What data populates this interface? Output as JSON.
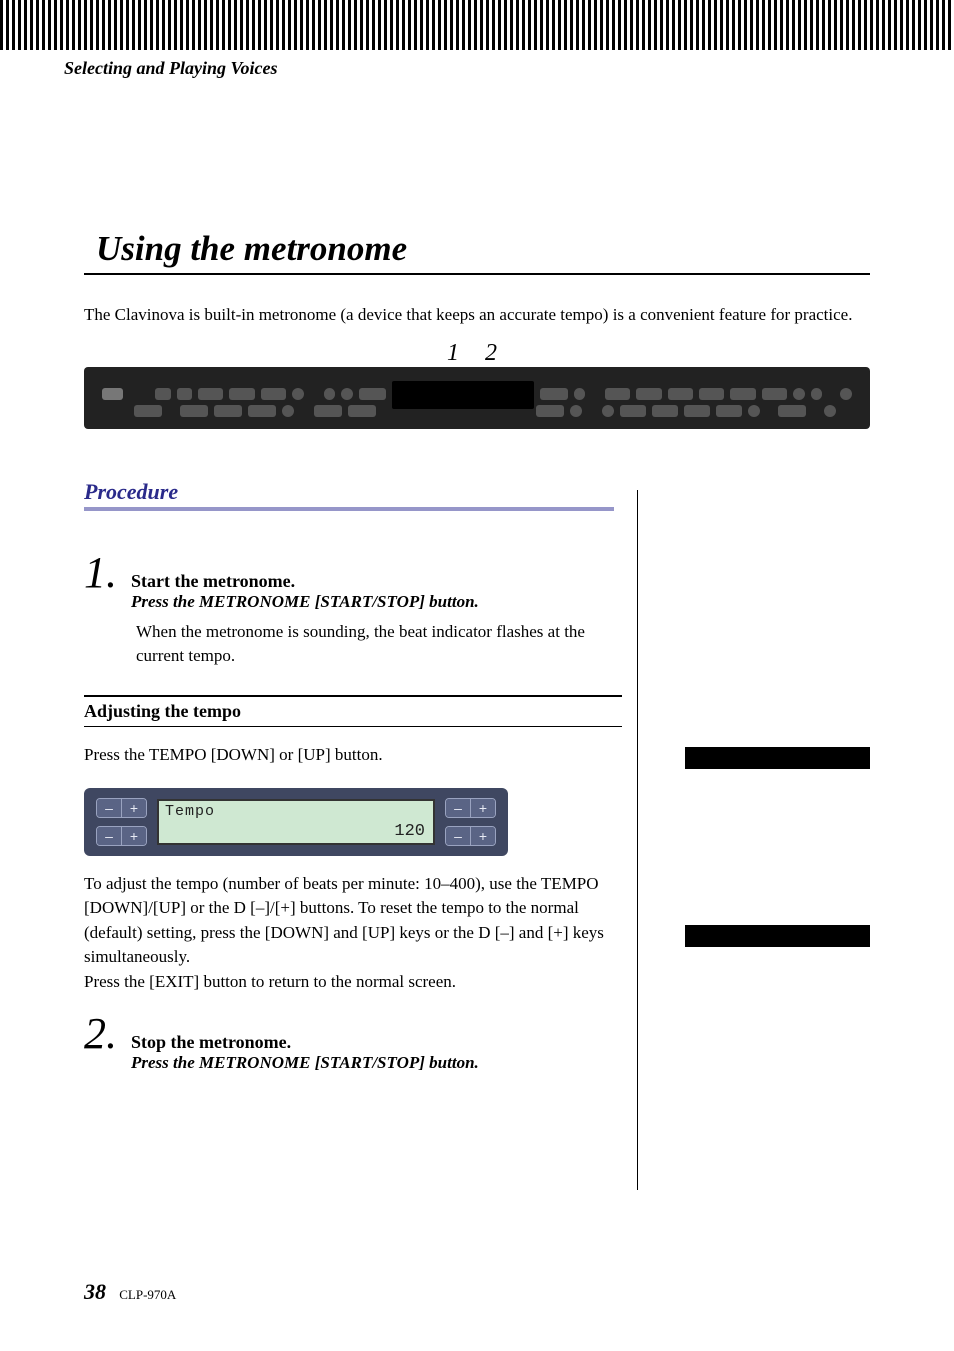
{
  "running_head": "Selecting and Playing Voices",
  "section_title": "Using the metronome",
  "intro": "The Clavinova is built-in metronome (a device that keeps an accurate tempo) is a convenient feature for practice.",
  "panel_markers": "1 2",
  "procedure_label": "Procedure",
  "steps": [
    {
      "num": "1.",
      "title": "Start the metronome.",
      "sub": "Press the METRONOME [START/STOP] button.",
      "body": "When the metronome is sounding, the beat indicator flashes at the current tempo."
    },
    {
      "num": "2.",
      "title": "Stop the metronome.",
      "sub": "Press the METRONOME [START/STOP] button.",
      "body": ""
    }
  ],
  "adjust_head": "Adjusting the tempo",
  "adjust_intro": "Press the TEMPO [DOWN] or [UP] button.",
  "lcd": {
    "label": "Tempo",
    "value": "120"
  },
  "adjust_body": "To adjust the tempo (number of beats per minute: 10–400), use the TEMPO [DOWN]/[UP] or the D [–]/[+] buttons. To reset the tempo to the normal (default) setting, press the [DOWN] and [UP] keys or the D [–] and [+] keys simultaneously.\nPress the [EXIT] button to return to the normal screen.",
  "footer": {
    "page": "38",
    "model": "CLP-970A"
  },
  "chart_data": {
    "type": "table",
    "title": "Tempo display",
    "rows": [
      [
        "Tempo",
        "120"
      ]
    ]
  }
}
